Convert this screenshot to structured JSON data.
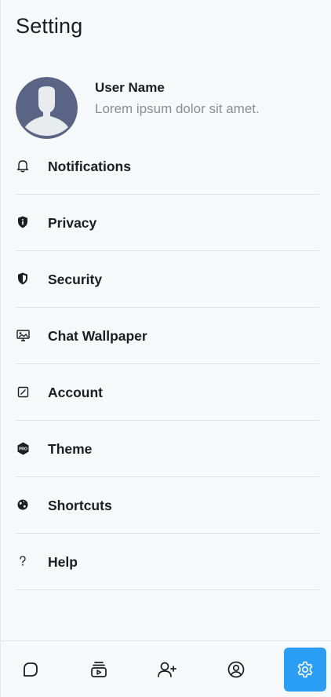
{
  "header": {
    "title": "Setting"
  },
  "profile": {
    "name": "User Name",
    "bio": "Lorem ipsum dolor sit amet."
  },
  "menu": [
    {
      "label": "Notifications",
      "icon": "bell-icon"
    },
    {
      "label": "Privacy",
      "icon": "shield-info-icon"
    },
    {
      "label": "Security",
      "icon": "shield-half-icon"
    },
    {
      "label": "Chat Wallpaper",
      "icon": "wallpaper-icon"
    },
    {
      "label": "Account",
      "icon": "edit-square-icon"
    },
    {
      "label": "Theme",
      "icon": "pro-hexagon-icon"
    },
    {
      "label": "Shortcuts",
      "icon": "globe-icon"
    },
    {
      "label": "Help",
      "icon": "question-icon"
    }
  ],
  "bottom_nav": [
    {
      "icon": "chat-icon",
      "active": false
    },
    {
      "icon": "media-stack-icon",
      "active": false
    },
    {
      "icon": "add-user-icon",
      "active": false
    },
    {
      "icon": "user-circle-icon",
      "active": false
    },
    {
      "icon": "gear-icon",
      "active": true
    }
  ],
  "colors": {
    "background": "#f7f8fa",
    "accent": "#2a9df4",
    "avatar": "#5a6485",
    "text": "#1a1d21",
    "muted": "#8a8d92"
  }
}
